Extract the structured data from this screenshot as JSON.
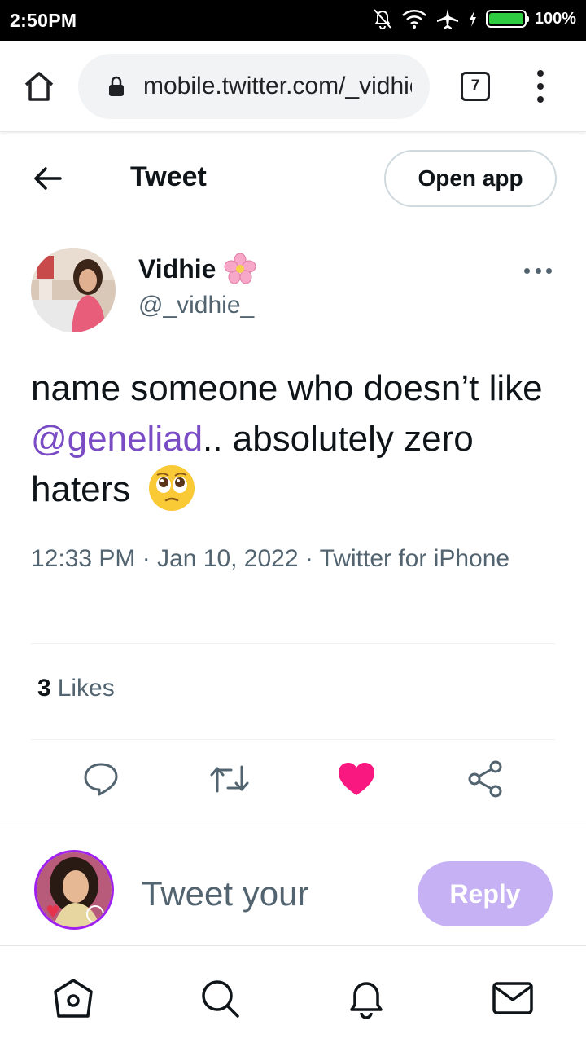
{
  "status_bar": {
    "time": "2:50PM",
    "battery_percent": "100%",
    "icons": [
      "bell-off-icon",
      "wifi-icon",
      "airplane-icon",
      "charging-icon",
      "battery-icon"
    ]
  },
  "browser": {
    "url": "mobile.twitter.com/_vidhie_",
    "tab_count": "7"
  },
  "header": {
    "title": "Tweet",
    "open_app_label": "Open app"
  },
  "tweet": {
    "author_name": "Vidhie",
    "author_handle": "@_vidhie_",
    "text_before": "name someone who doesn’t like ",
    "mention": "@geneliad",
    "text_after": ".. absolutely zero haters",
    "timestamp": "12:33 PM · Jan 10, 2022 · Twitter for iPhone",
    "likes_count": "3",
    "likes_label": "Likes",
    "liked": true
  },
  "reply": {
    "placeholder": "Tweet your",
    "button_label": "Reply"
  },
  "colors": {
    "mention": "#794bc4",
    "like": "#f91880",
    "reply_button": "#c6b1f5",
    "secondary_text": "#536471"
  },
  "bottom_nav": [
    "home-icon",
    "search-icon",
    "notifications-icon",
    "messages-icon"
  ]
}
